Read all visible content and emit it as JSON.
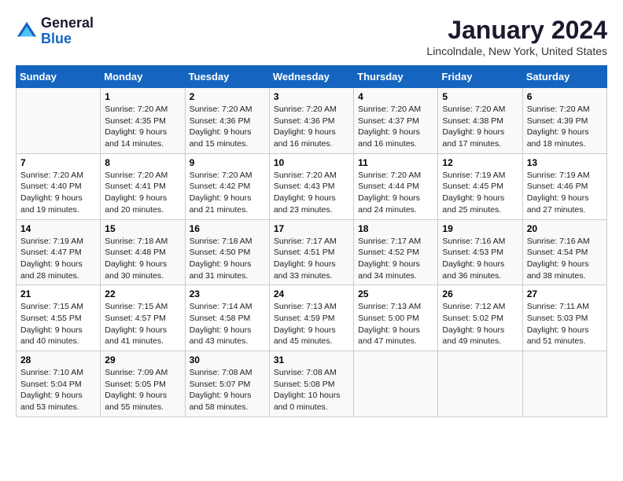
{
  "header": {
    "logo_line1": "General",
    "logo_line2": "Blue",
    "title": "January 2024",
    "subtitle": "Lincolndale, New York, United States"
  },
  "columns": [
    "Sunday",
    "Monday",
    "Tuesday",
    "Wednesday",
    "Thursday",
    "Friday",
    "Saturday"
  ],
  "weeks": [
    [
      {
        "day": "",
        "info": ""
      },
      {
        "day": "1",
        "info": "Sunrise: 7:20 AM\nSunset: 4:35 PM\nDaylight: 9 hours\nand 14 minutes."
      },
      {
        "day": "2",
        "info": "Sunrise: 7:20 AM\nSunset: 4:36 PM\nDaylight: 9 hours\nand 15 minutes."
      },
      {
        "day": "3",
        "info": "Sunrise: 7:20 AM\nSunset: 4:36 PM\nDaylight: 9 hours\nand 16 minutes."
      },
      {
        "day": "4",
        "info": "Sunrise: 7:20 AM\nSunset: 4:37 PM\nDaylight: 9 hours\nand 16 minutes."
      },
      {
        "day": "5",
        "info": "Sunrise: 7:20 AM\nSunset: 4:38 PM\nDaylight: 9 hours\nand 17 minutes."
      },
      {
        "day": "6",
        "info": "Sunrise: 7:20 AM\nSunset: 4:39 PM\nDaylight: 9 hours\nand 18 minutes."
      }
    ],
    [
      {
        "day": "7",
        "info": "Sunrise: 7:20 AM\nSunset: 4:40 PM\nDaylight: 9 hours\nand 19 minutes."
      },
      {
        "day": "8",
        "info": "Sunrise: 7:20 AM\nSunset: 4:41 PM\nDaylight: 9 hours\nand 20 minutes."
      },
      {
        "day": "9",
        "info": "Sunrise: 7:20 AM\nSunset: 4:42 PM\nDaylight: 9 hours\nand 21 minutes."
      },
      {
        "day": "10",
        "info": "Sunrise: 7:20 AM\nSunset: 4:43 PM\nDaylight: 9 hours\nand 23 minutes."
      },
      {
        "day": "11",
        "info": "Sunrise: 7:20 AM\nSunset: 4:44 PM\nDaylight: 9 hours\nand 24 minutes."
      },
      {
        "day": "12",
        "info": "Sunrise: 7:19 AM\nSunset: 4:45 PM\nDaylight: 9 hours\nand 25 minutes."
      },
      {
        "day": "13",
        "info": "Sunrise: 7:19 AM\nSunset: 4:46 PM\nDaylight: 9 hours\nand 27 minutes."
      }
    ],
    [
      {
        "day": "14",
        "info": "Sunrise: 7:19 AM\nSunset: 4:47 PM\nDaylight: 9 hours\nand 28 minutes."
      },
      {
        "day": "15",
        "info": "Sunrise: 7:18 AM\nSunset: 4:48 PM\nDaylight: 9 hours\nand 30 minutes."
      },
      {
        "day": "16",
        "info": "Sunrise: 7:18 AM\nSunset: 4:50 PM\nDaylight: 9 hours\nand 31 minutes."
      },
      {
        "day": "17",
        "info": "Sunrise: 7:17 AM\nSunset: 4:51 PM\nDaylight: 9 hours\nand 33 minutes."
      },
      {
        "day": "18",
        "info": "Sunrise: 7:17 AM\nSunset: 4:52 PM\nDaylight: 9 hours\nand 34 minutes."
      },
      {
        "day": "19",
        "info": "Sunrise: 7:16 AM\nSunset: 4:53 PM\nDaylight: 9 hours\nand 36 minutes."
      },
      {
        "day": "20",
        "info": "Sunrise: 7:16 AM\nSunset: 4:54 PM\nDaylight: 9 hours\nand 38 minutes."
      }
    ],
    [
      {
        "day": "21",
        "info": "Sunrise: 7:15 AM\nSunset: 4:55 PM\nDaylight: 9 hours\nand 40 minutes."
      },
      {
        "day": "22",
        "info": "Sunrise: 7:15 AM\nSunset: 4:57 PM\nDaylight: 9 hours\nand 41 minutes."
      },
      {
        "day": "23",
        "info": "Sunrise: 7:14 AM\nSunset: 4:58 PM\nDaylight: 9 hours\nand 43 minutes."
      },
      {
        "day": "24",
        "info": "Sunrise: 7:13 AM\nSunset: 4:59 PM\nDaylight: 9 hours\nand 45 minutes."
      },
      {
        "day": "25",
        "info": "Sunrise: 7:13 AM\nSunset: 5:00 PM\nDaylight: 9 hours\nand 47 minutes."
      },
      {
        "day": "26",
        "info": "Sunrise: 7:12 AM\nSunset: 5:02 PM\nDaylight: 9 hours\nand 49 minutes."
      },
      {
        "day": "27",
        "info": "Sunrise: 7:11 AM\nSunset: 5:03 PM\nDaylight: 9 hours\nand 51 minutes."
      }
    ],
    [
      {
        "day": "28",
        "info": "Sunrise: 7:10 AM\nSunset: 5:04 PM\nDaylight: 9 hours\nand 53 minutes."
      },
      {
        "day": "29",
        "info": "Sunrise: 7:09 AM\nSunset: 5:05 PM\nDaylight: 9 hours\nand 55 minutes."
      },
      {
        "day": "30",
        "info": "Sunrise: 7:08 AM\nSunset: 5:07 PM\nDaylight: 9 hours\nand 58 minutes."
      },
      {
        "day": "31",
        "info": "Sunrise: 7:08 AM\nSunset: 5:08 PM\nDaylight: 10 hours\nand 0 minutes."
      },
      {
        "day": "",
        "info": ""
      },
      {
        "day": "",
        "info": ""
      },
      {
        "day": "",
        "info": ""
      }
    ]
  ]
}
